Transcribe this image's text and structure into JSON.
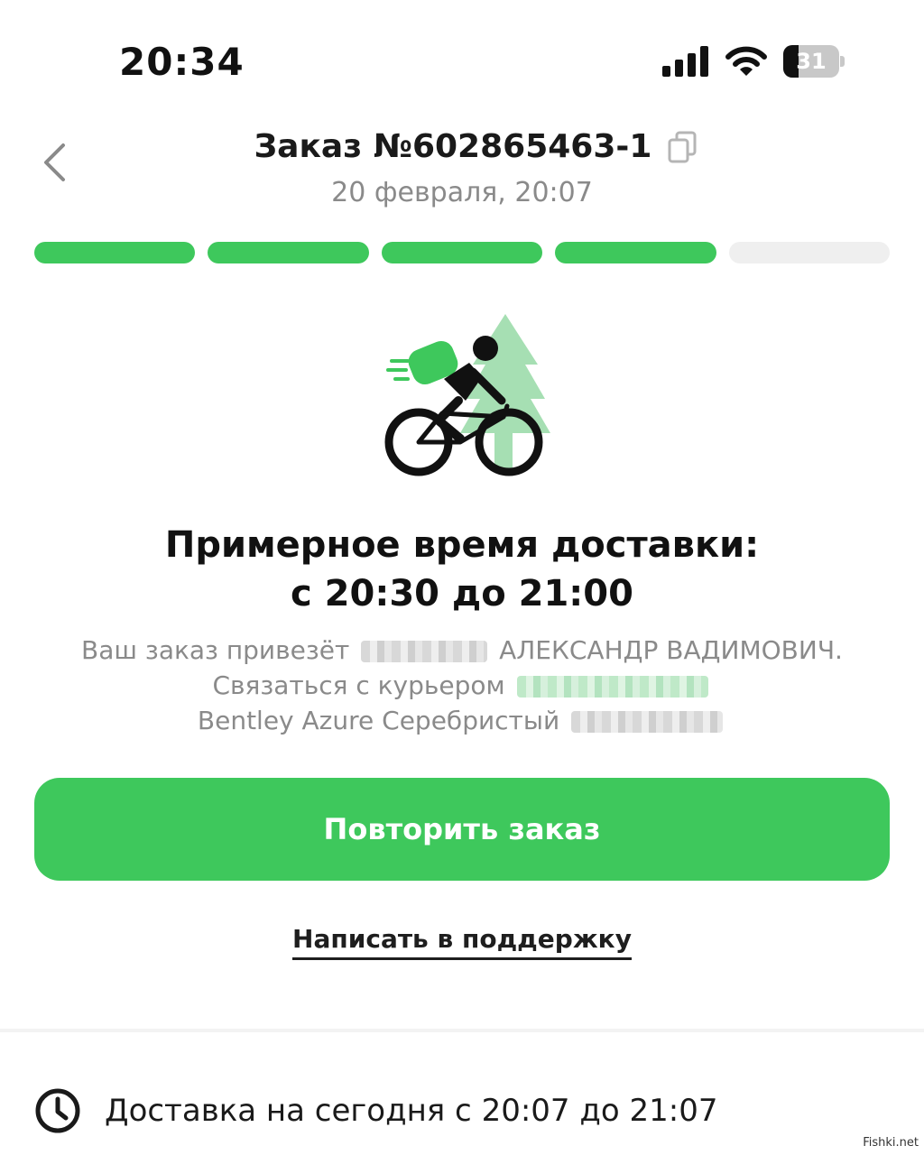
{
  "status_bar": {
    "time": "20:34",
    "battery_level": "31"
  },
  "header": {
    "order_title": "Заказ №602865463-1",
    "order_date": "20 февраля, 20:07"
  },
  "progress": {
    "total_steps": 5,
    "completed_steps": 4,
    "accent_color": "#3ec85c"
  },
  "eta": {
    "title": "Примерное время доставки:",
    "range": "с 20:30 до 21:00"
  },
  "courier": {
    "line1_prefix": "Ваш заказ привезёт",
    "line1_name": "АЛЕКСАНДР ВАДИМОВИЧ.",
    "line2_prefix": "Связаться с курьером",
    "line3_prefix": "Bentley Azure Серебристый"
  },
  "actions": {
    "repeat_order": "Повторить заказ",
    "support": "Написать в поддержку"
  },
  "delivery": {
    "text": "Доставка на сегодня с 20:07 до 21:07"
  },
  "watermark": "Fishki.net",
  "icons": [
    "signal-icon",
    "wifi-icon",
    "battery-icon",
    "back-chevron-icon",
    "copy-icon",
    "courier-bicycle-icon",
    "clock-icon"
  ]
}
